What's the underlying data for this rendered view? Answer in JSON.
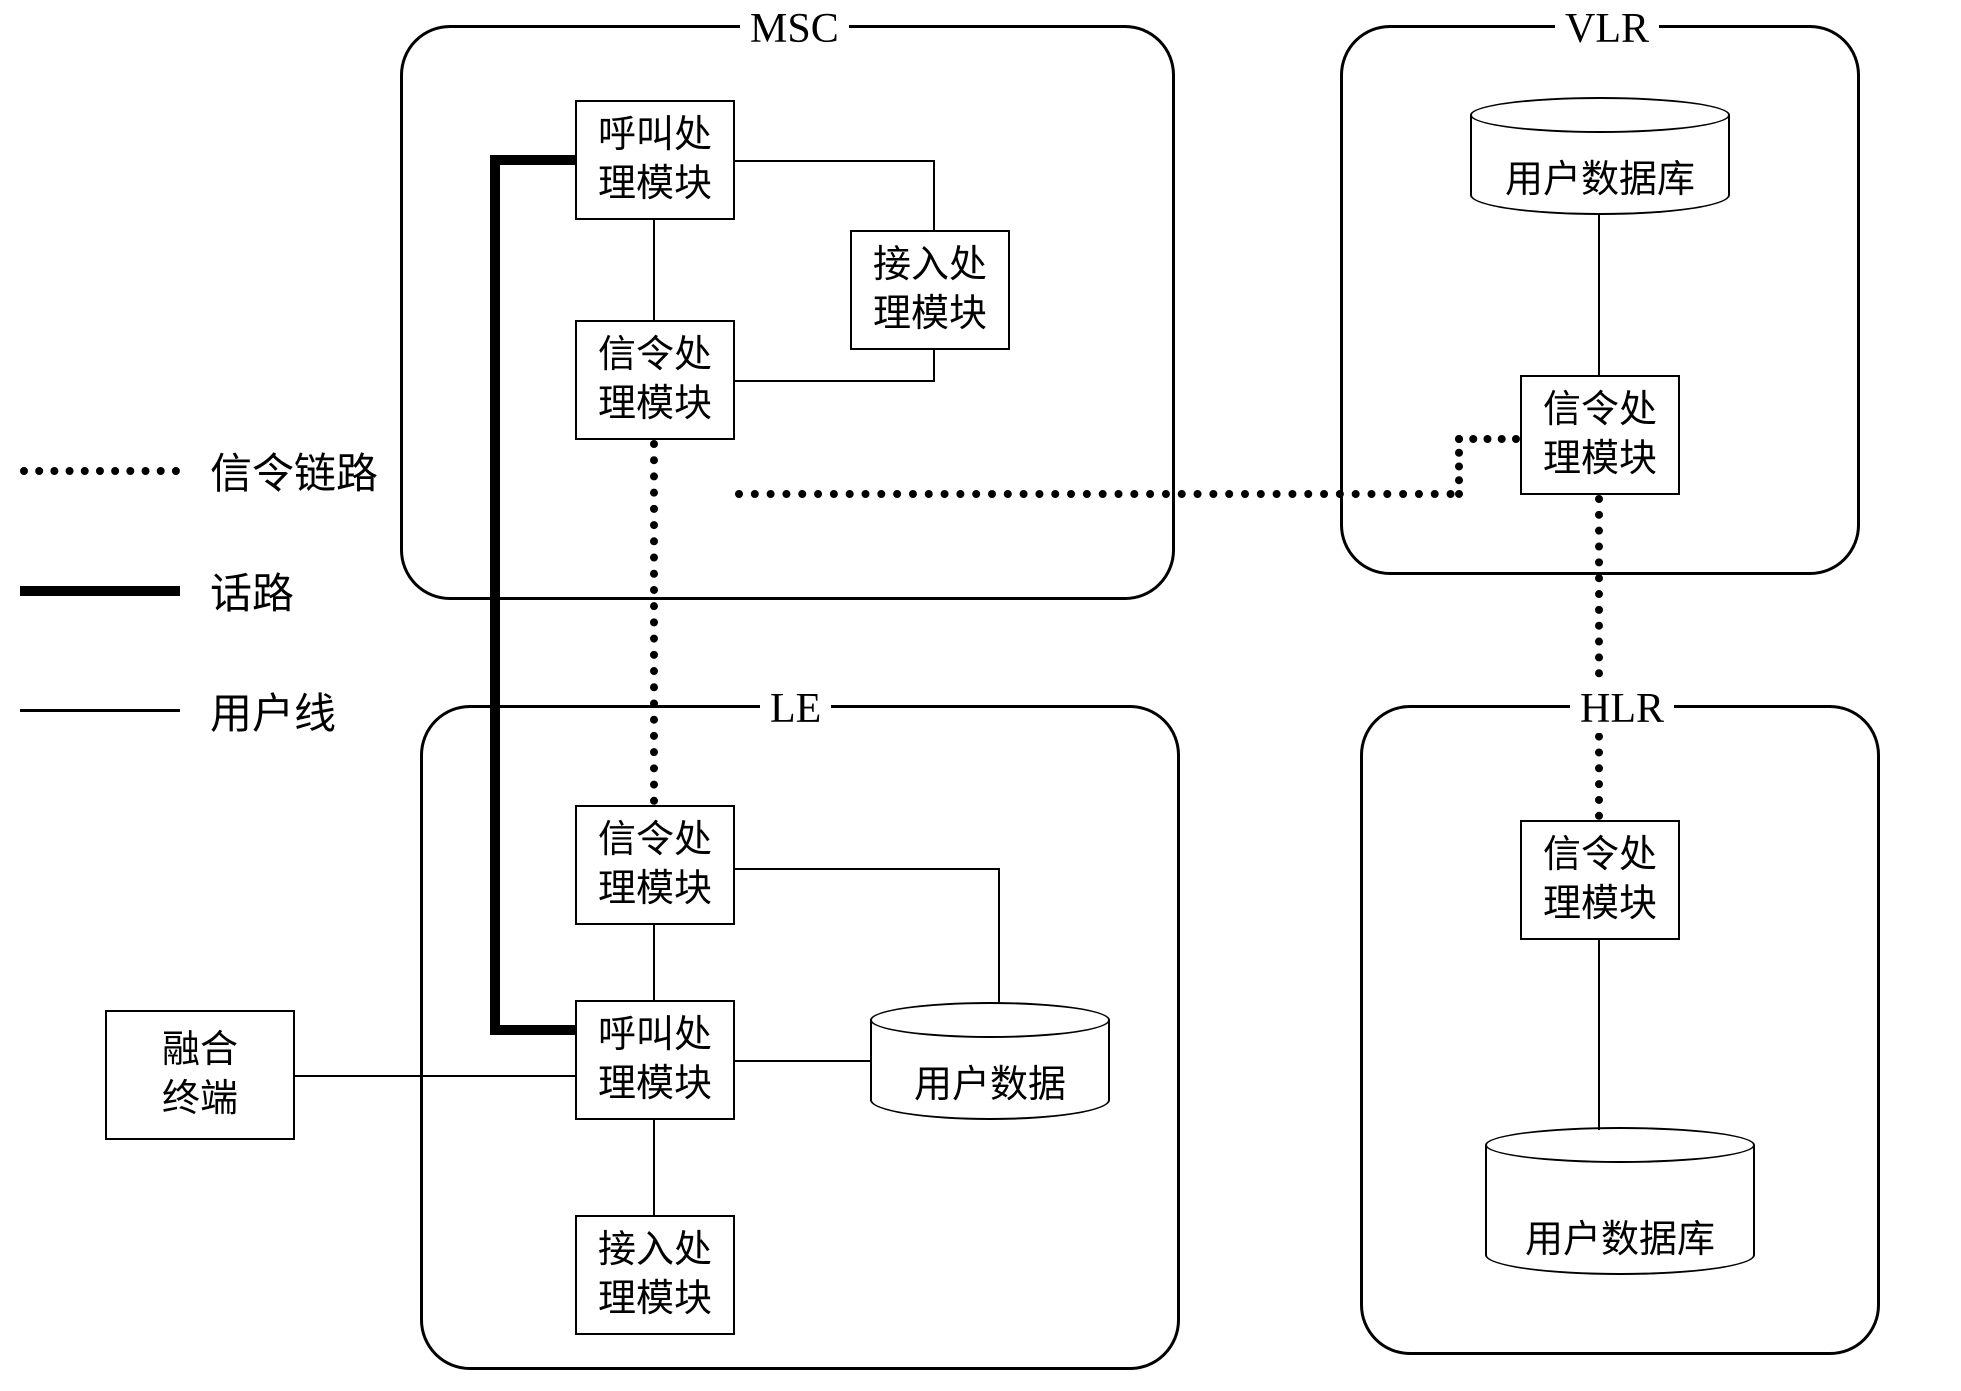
{
  "boxes": {
    "msc": {
      "title": "MSC"
    },
    "vlr": {
      "title": "VLR"
    },
    "le": {
      "title": "LE"
    },
    "hlr": {
      "title": "HLR"
    }
  },
  "modules": {
    "msc_call": {
      "line1": "呼叫处",
      "line2": "理模块"
    },
    "msc_signal": {
      "line1": "信令处",
      "line2": "理模块"
    },
    "msc_access": {
      "line1": "接入处",
      "line2": "理模块"
    },
    "vlr_signal": {
      "line1": "信令处",
      "line2": "理模块"
    },
    "le_signal": {
      "line1": "信令处",
      "line2": "理模块"
    },
    "le_call": {
      "line1": "呼叫处",
      "line2": "理模块"
    },
    "le_access": {
      "line1": "接入处",
      "line2": "理模块"
    },
    "hlr_signal": {
      "line1": "信令处",
      "line2": "理模块"
    },
    "terminal": {
      "line1": "融合",
      "line2": "终端"
    }
  },
  "cylinders": {
    "vlr_db": {
      "label": "用户数据库"
    },
    "le_db": {
      "label": "用户数据"
    },
    "hlr_db": {
      "label": "用户数据库"
    }
  },
  "legend": {
    "signal_link": "信令链路",
    "voice_path": "话路",
    "user_line": "用户线"
  }
}
